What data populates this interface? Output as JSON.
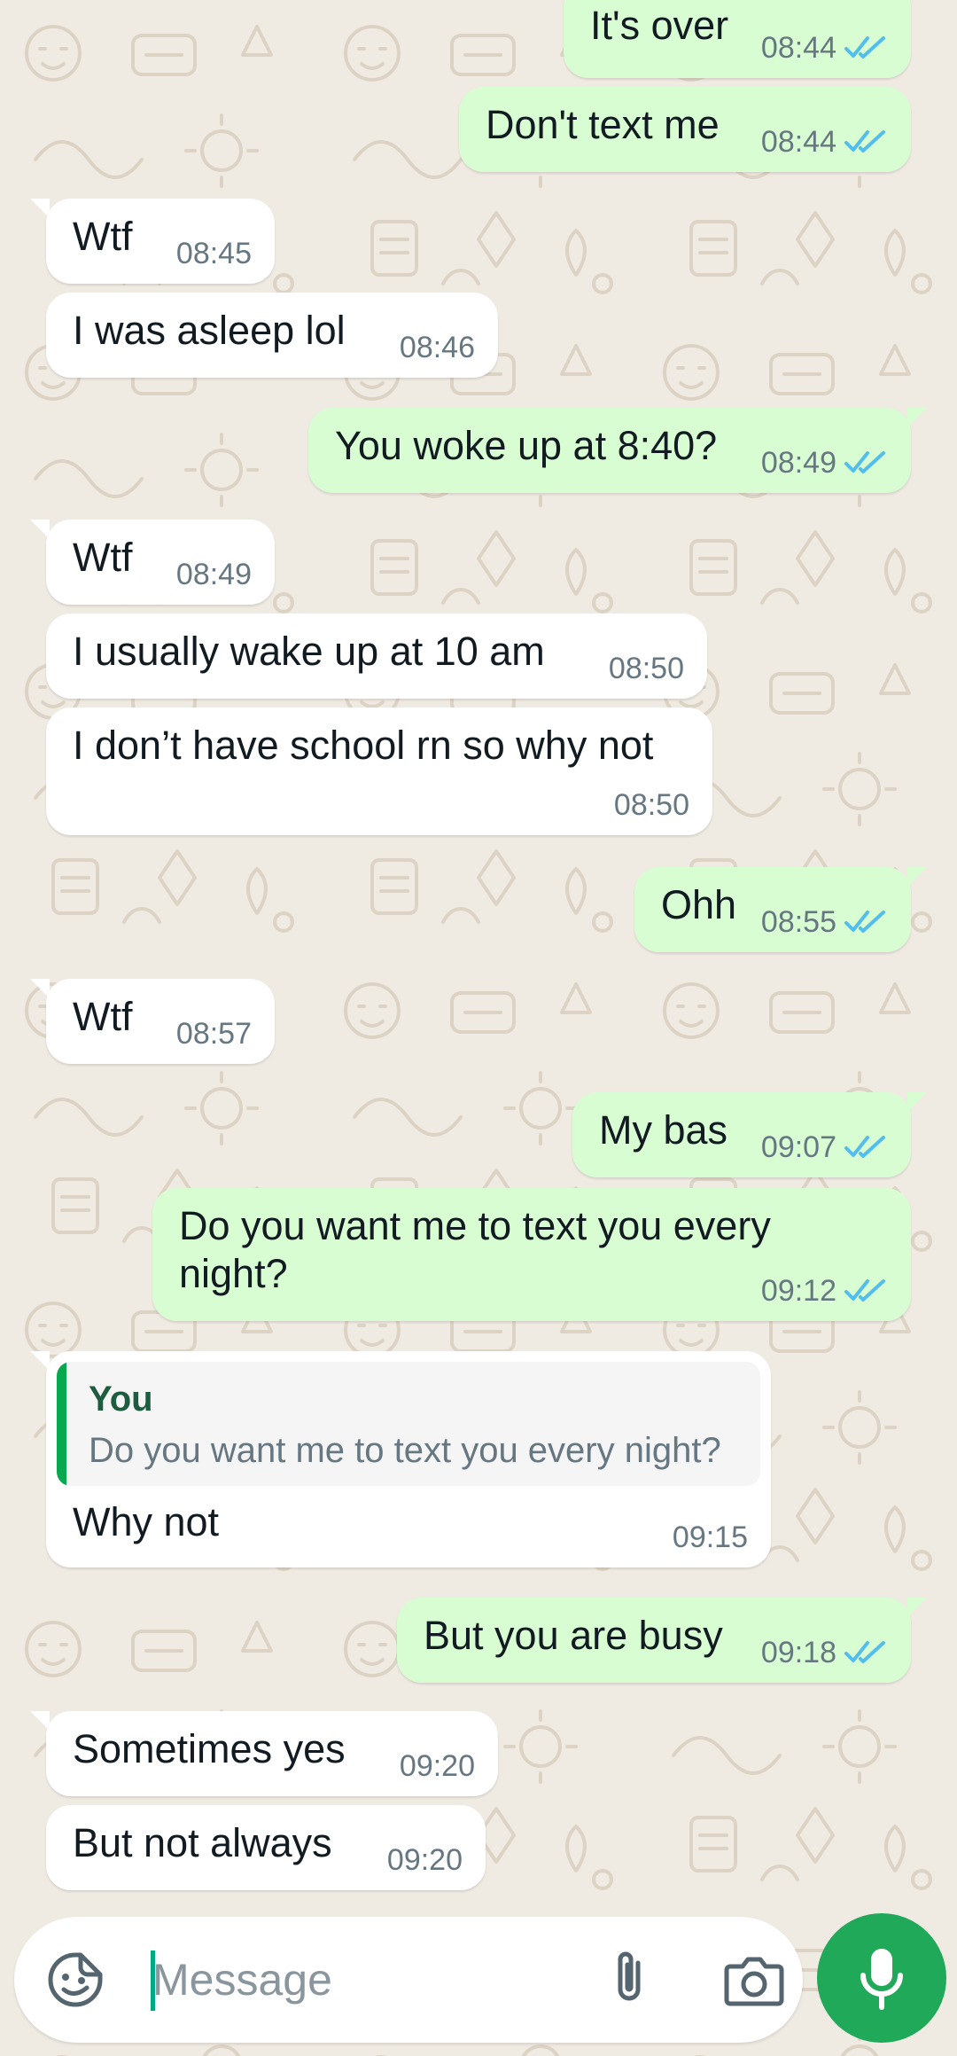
{
  "messages": [
    {
      "dir": "out",
      "text": "It's over",
      "time": "08:44",
      "status": "read"
    },
    {
      "dir": "out",
      "text": "Don't text me",
      "time": "08:44",
      "status": "read"
    },
    {
      "dir": "in",
      "text": "Wtf",
      "time": "08:45"
    },
    {
      "dir": "in",
      "text": "I was asleep lol",
      "time": "08:46"
    },
    {
      "dir": "out",
      "text": "You woke up at 8:40?",
      "time": "08:49",
      "status": "read"
    },
    {
      "dir": "in",
      "text": "Wtf",
      "time": "08:49"
    },
    {
      "dir": "in",
      "text": "I usually wake up at 10 am",
      "time": "08:50"
    },
    {
      "dir": "in",
      "text": "I don’t have school rn so why not",
      "time": "08:50"
    },
    {
      "dir": "out",
      "text": "Ohh",
      "time": "08:55",
      "status": "read"
    },
    {
      "dir": "in",
      "text": "Wtf",
      "time": "08:57"
    },
    {
      "dir": "out",
      "text": "My bas",
      "time": "09:07",
      "status": "read"
    },
    {
      "dir": "out",
      "text": "Do you want me to text you every night?",
      "time": "09:12",
      "status": "read"
    },
    {
      "dir": "in",
      "text": "Why not",
      "time": "09:15",
      "reply_author": "You",
      "reply_text": "Do you want me to text you every night?"
    },
    {
      "dir": "out",
      "text": "But you are busy",
      "time": "09:18",
      "status": "read"
    },
    {
      "dir": "in",
      "text": "Sometimes yes",
      "time": "09:20"
    },
    {
      "dir": "in",
      "text": "But not always",
      "time": "09:20"
    }
  ],
  "composer": {
    "placeholder": "Message",
    "emoji_icon": "sticker-emoji-icon",
    "attach_icon": "paperclip-icon",
    "camera_icon": "camera-icon",
    "send_icon": "microphone-icon"
  },
  "colors": {
    "background": "#efeae2",
    "outgoing_bubble": "#d9fdd3",
    "incoming_bubble": "#ffffff",
    "read_ticks": "#53bdeb",
    "accent": "#20a958"
  }
}
